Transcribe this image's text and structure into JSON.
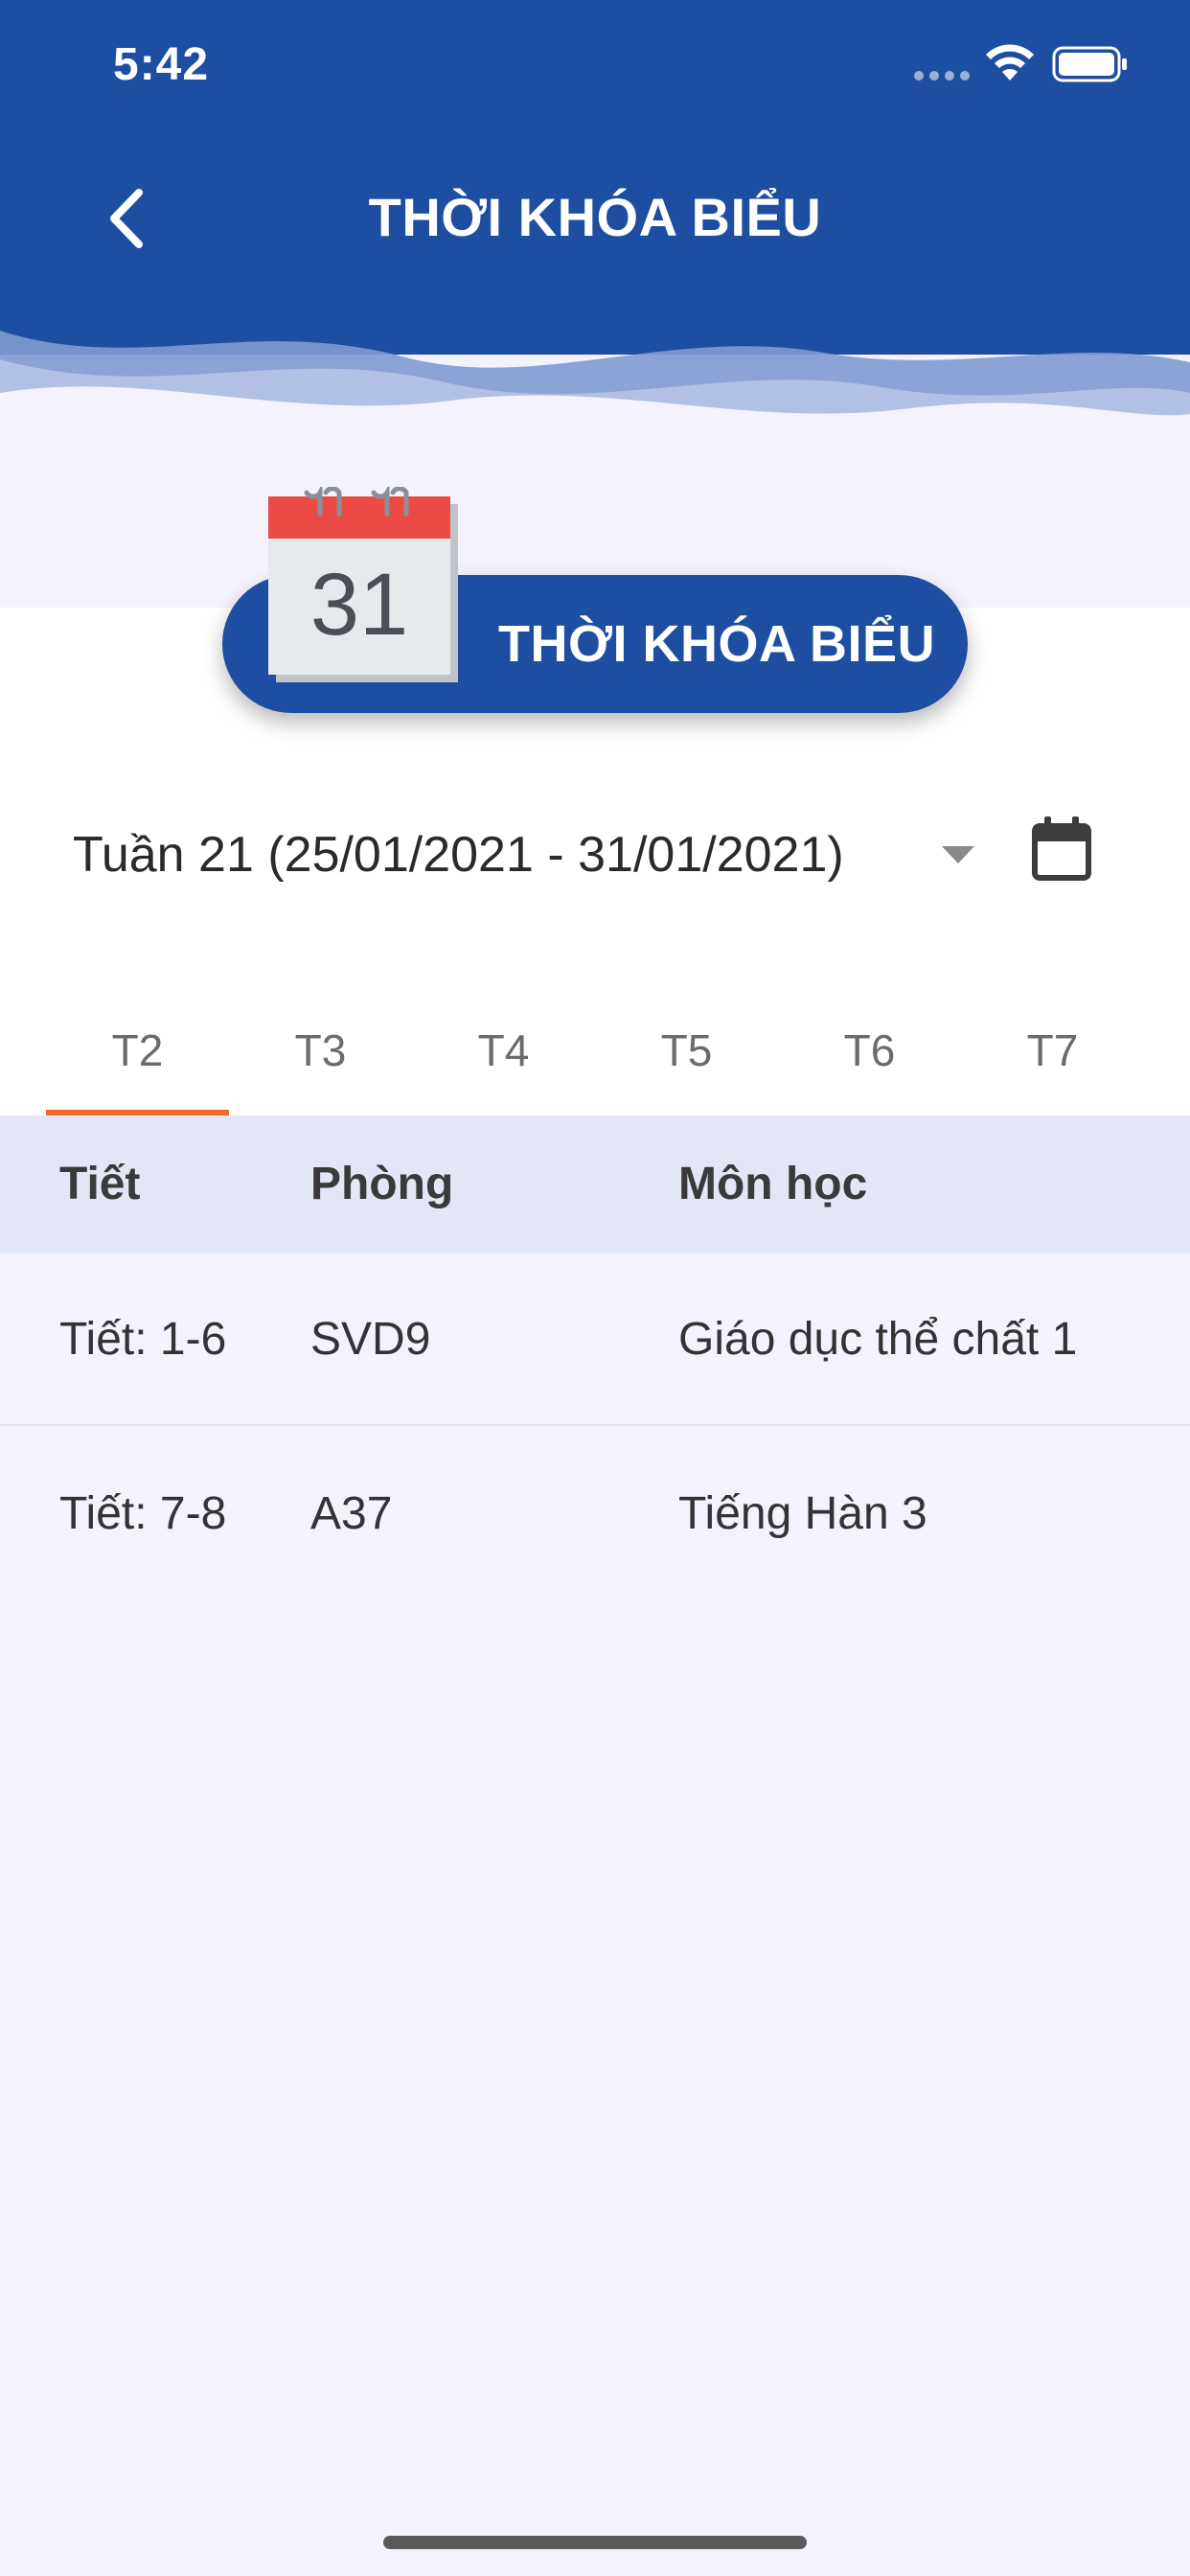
{
  "status_bar": {
    "time": "5:42"
  },
  "header": {
    "title": "THỜI KHÓA BIỂU",
    "bg_color": "#1e4ea2",
    "back_icon": "chevron-left-icon"
  },
  "banner": {
    "label": "THỜI KHÓA BIỂU",
    "calendar_day": "31",
    "pill_color": "#1e4ea2"
  },
  "week_selector": {
    "selected_week": "Tuần 21 (25/01/2021 - 31/01/2021)",
    "dropdown_icon": "caret-down-icon",
    "calendar_icon": "calendar-icon"
  },
  "tabs": [
    {
      "label": "T2",
      "active": true
    },
    {
      "label": "T3",
      "active": false
    },
    {
      "label": "T4",
      "active": false
    },
    {
      "label": "T5",
      "active": false
    },
    {
      "label": "T6",
      "active": false
    },
    {
      "label": "T7",
      "active": false
    }
  ],
  "active_tab_color": "#ee6a2c",
  "table": {
    "columns": [
      "Tiết",
      "Phòng",
      "Môn học"
    ],
    "rows": [
      {
        "period": "Tiết: 1-6",
        "room": "SVD9",
        "subject": "Giáo dục thể chất 1"
      },
      {
        "period": "Tiết: 7-8",
        "room": "A37",
        "subject": "Tiếng Hàn 3"
      }
    ]
  }
}
